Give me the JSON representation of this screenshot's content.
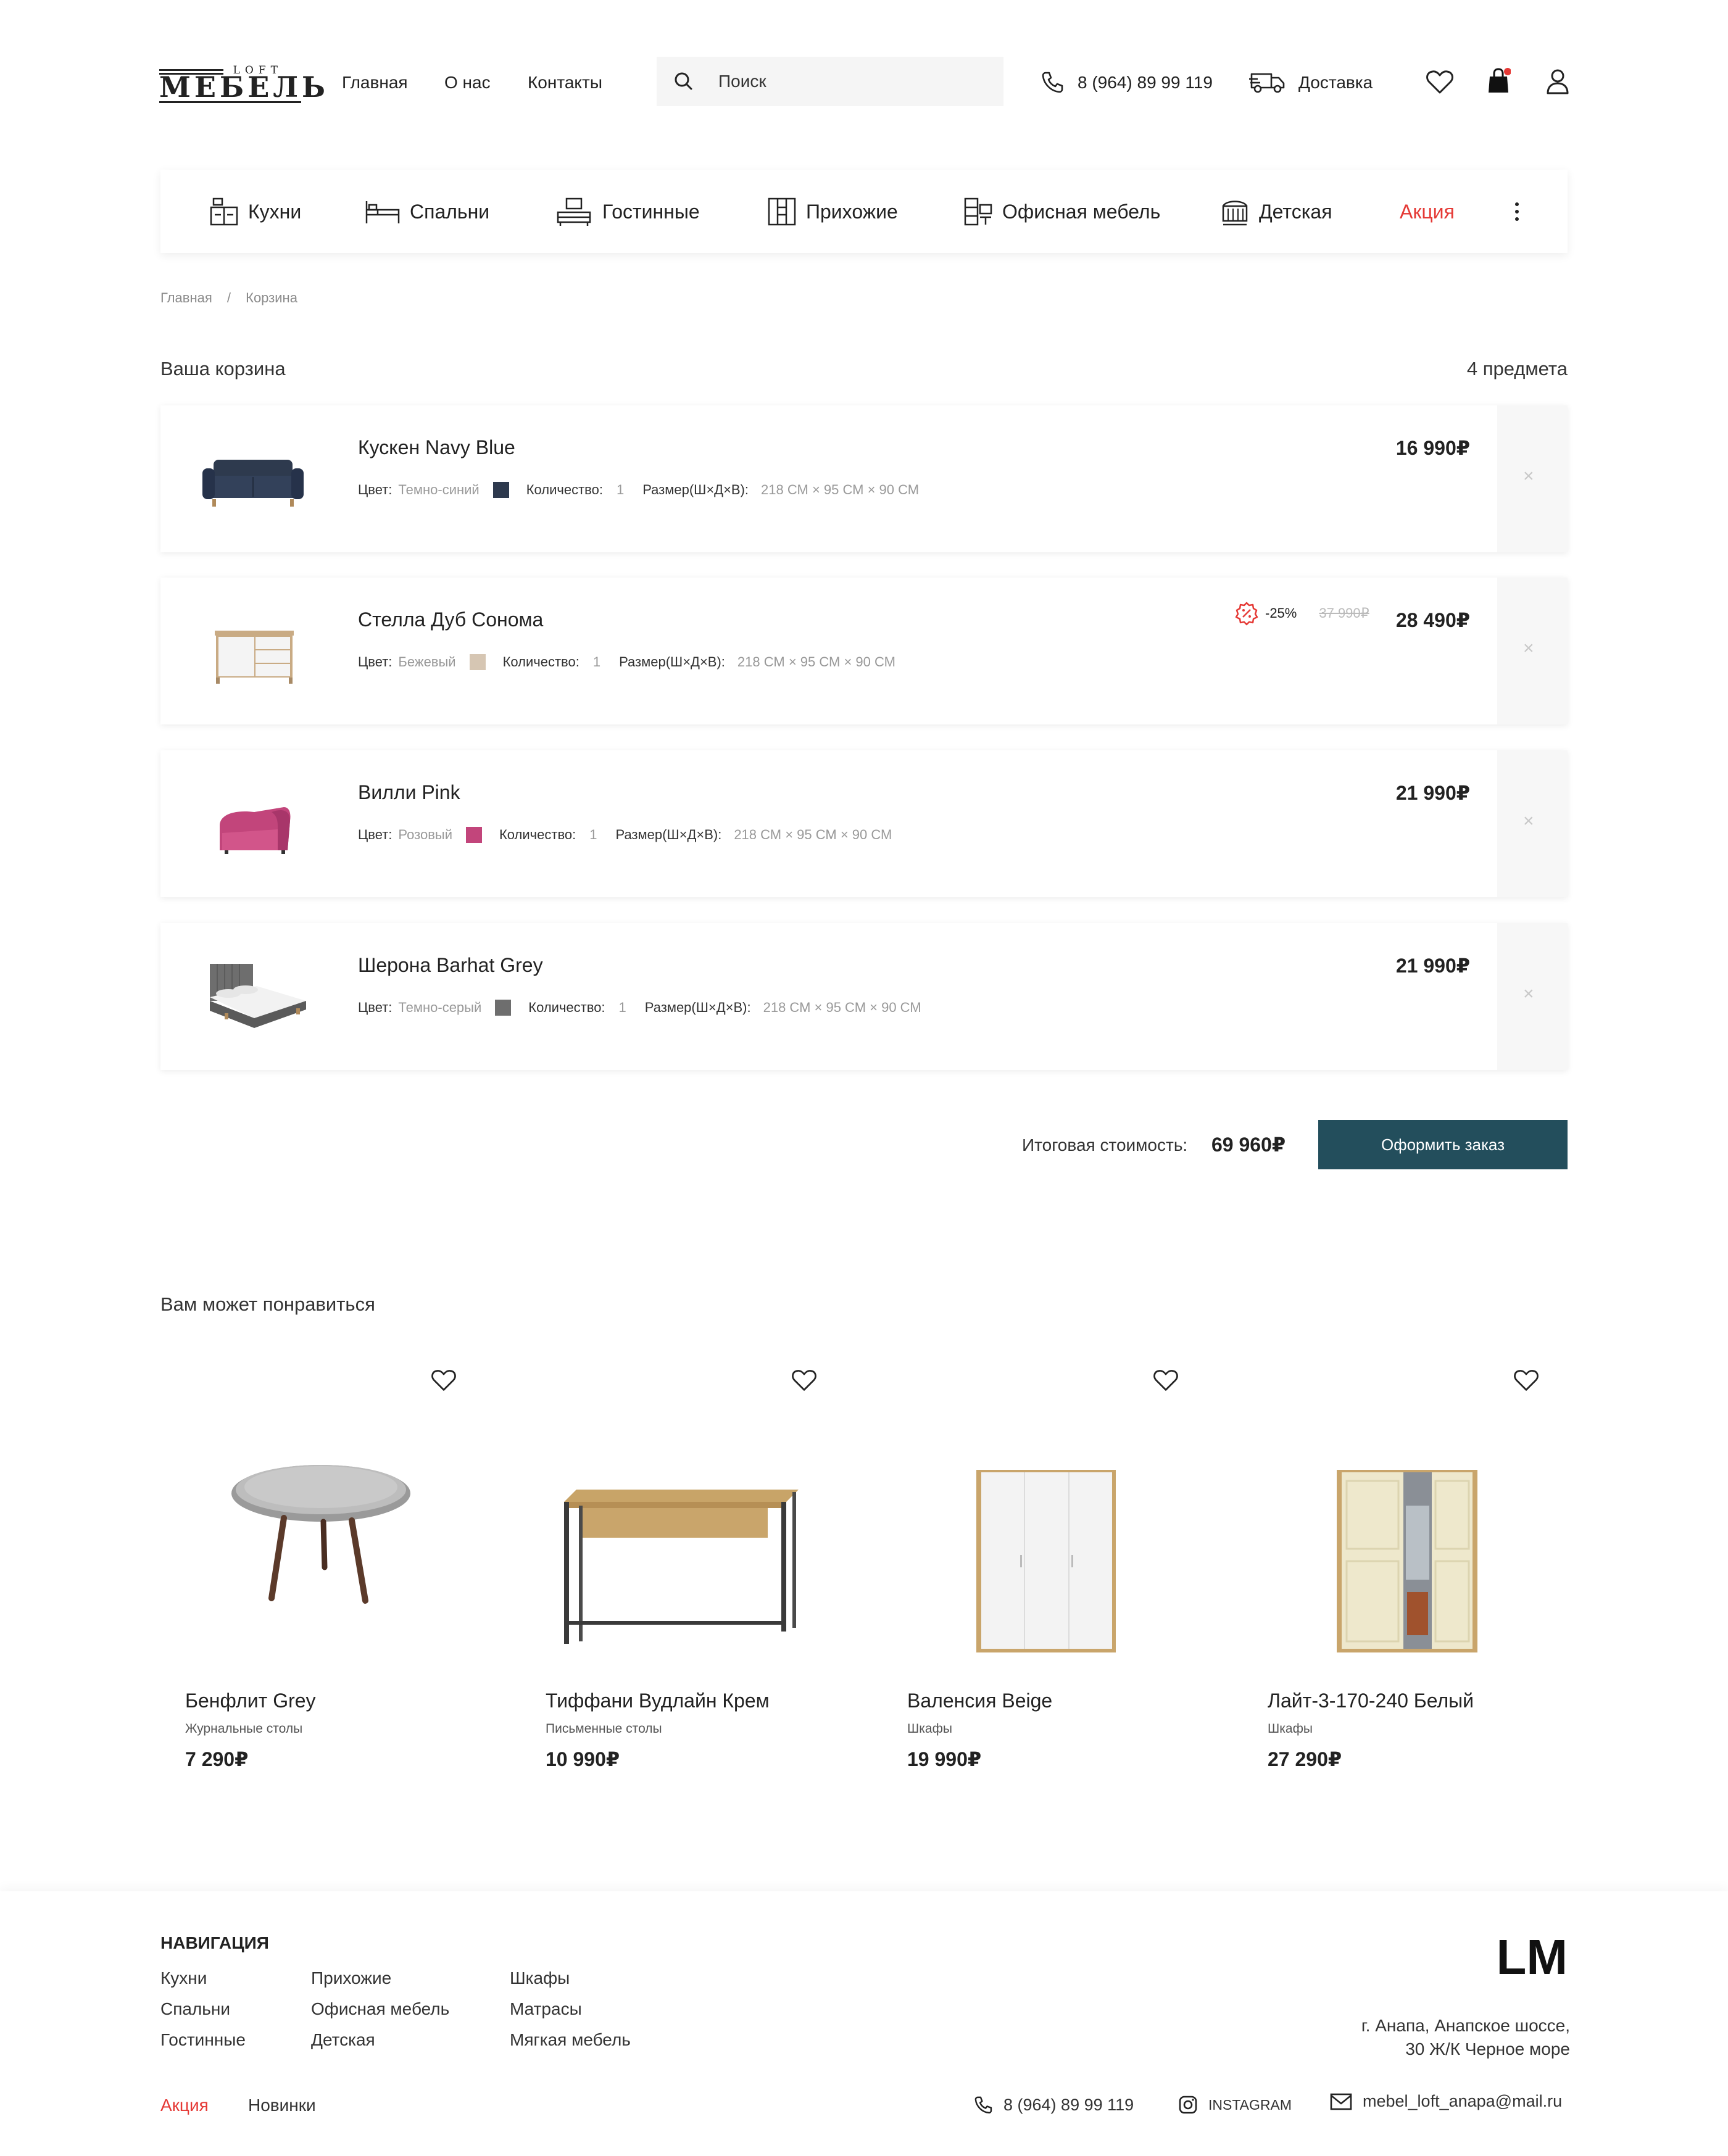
{
  "header": {
    "logo_small": "LOFT",
    "logo_big": "МЕБЕЛЬ",
    "nav": [
      "Главная",
      "О нас",
      "Контакты"
    ],
    "search_placeholder": "Поиск",
    "phone": "8 (964) 89 99 119",
    "delivery": "Доставка",
    "icons": [
      "search-icon",
      "phone-icon",
      "truck-icon",
      "heart-icon",
      "bag-icon",
      "user-icon"
    ]
  },
  "categories": [
    {
      "label": "Кухни",
      "icon": "kitchen-icon"
    },
    {
      "label": "Спальни",
      "icon": "bed-icon"
    },
    {
      "label": "Гостинные",
      "icon": "living-room-icon"
    },
    {
      "label": "Прихожие",
      "icon": "hallway-icon"
    },
    {
      "label": "Офисная мебель",
      "icon": "office-icon"
    },
    {
      "label": "Детская",
      "icon": "crib-icon"
    },
    {
      "label": "Акция",
      "color": "#e53935"
    }
  ],
  "breadcrumb": {
    "home": "Главная",
    "sep": "/",
    "current": "Корзина"
  },
  "cart": {
    "title": "Ваша корзина",
    "count": "4 предмета",
    "color_label": "Цвет:",
    "qty_label": "Количество:",
    "size_label": "Размер(Ш×Д×В):",
    "items": [
      {
        "name": "Кускен Navy Blue",
        "color": "Темно-синий",
        "swatch": "#2e3a4e",
        "qty": "1",
        "size": "218 СМ  ×  95 СМ  ×  90 СМ",
        "price": "16 990₽"
      },
      {
        "name": "Стелла Дуб Сонома",
        "color": "Бежевый",
        "swatch": "#d6c6b3",
        "qty": "1",
        "size": "218 СМ  ×  95 СМ  ×  90 СМ",
        "price": "28 490₽",
        "discount": "-25%",
        "old_price": "37 990₽"
      },
      {
        "name": "Вилли Pink",
        "color": "Розовый",
        "swatch": "#c2457b",
        "qty": "1",
        "size": "218 СМ  ×  95 СМ  ×  90 СМ",
        "price": "21 990₽"
      },
      {
        "name": "Шерона Barhat Grey",
        "color": "Темно-серый",
        "swatch": "#6e6e6e",
        "qty": "1",
        "size": "218 СМ  ×  95 СМ  ×  90 СМ",
        "price": "21 990₽"
      }
    ],
    "remove": "×",
    "total_label": "Итоговая стоимость:",
    "total": "69 960₽",
    "order_button": "Оформить заказ"
  },
  "recommendations": {
    "title": "Вам может понравиться",
    "items": [
      {
        "name": "Бенфлит Grey",
        "category": "Журнальные столы",
        "price": "7 290₽"
      },
      {
        "name": "Тиффани Вудлайн Крем",
        "category": "Письменные столы",
        "price": "10 990₽"
      },
      {
        "name": "Валенсия Beige",
        "category": "Шкафы",
        "price": "19 990₽"
      },
      {
        "name": "Лайт-3-170-240 Белый",
        "category": "Шкафы",
        "price": "27 290₽"
      }
    ]
  },
  "footer": {
    "nav_title": "НАВИГАЦИЯ",
    "col1": [
      "Кухни",
      "Спальни",
      "Гостинные"
    ],
    "col2": [
      "Прихожие",
      "Офисная мебель",
      "Детская"
    ],
    "col3": [
      "Шкафы",
      "Матрасы",
      "Мягкая мебель"
    ],
    "sale": "Акция",
    "new": "Новинки",
    "logo": "LM",
    "address_line1": "г. Анапа, Анапское шоссе,",
    "address_line2": "30 Ж/К Черное море",
    "phone": "8 (964) 89 99 119",
    "instagram": "INSTAGRAM",
    "email": "mebel_loft_anapa@mail.ru"
  },
  "colors": {
    "accent": "#234e5c",
    "sale": "#e53935",
    "cart_dot": "#e53935"
  }
}
